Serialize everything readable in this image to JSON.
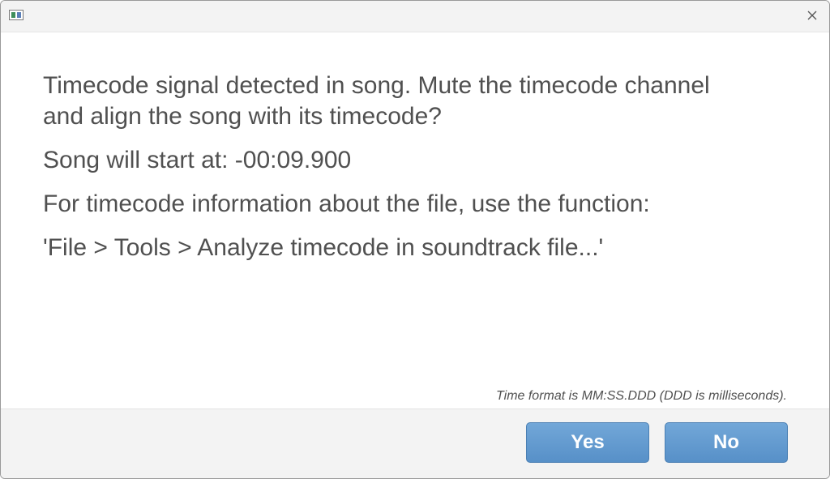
{
  "window": {
    "close_icon": "close-icon",
    "app_icon": "app-icon"
  },
  "message": {
    "question": "Timecode signal detected in song.  Mute the timecode channel and align the song with its timecode?",
    "start": "Song will start at: -00:09.900",
    "info": "For timecode information about the file, use the function:",
    "menu_path": "'File > Tools > Analyze timecode in soundtrack file...'"
  },
  "footer": {
    "note": "Time format is MM:SS.DDD (DDD is milliseconds).",
    "yes_label": "Yes",
    "no_label": "No"
  },
  "colors": {
    "button": "#6a9fd2",
    "text": "#505050"
  }
}
